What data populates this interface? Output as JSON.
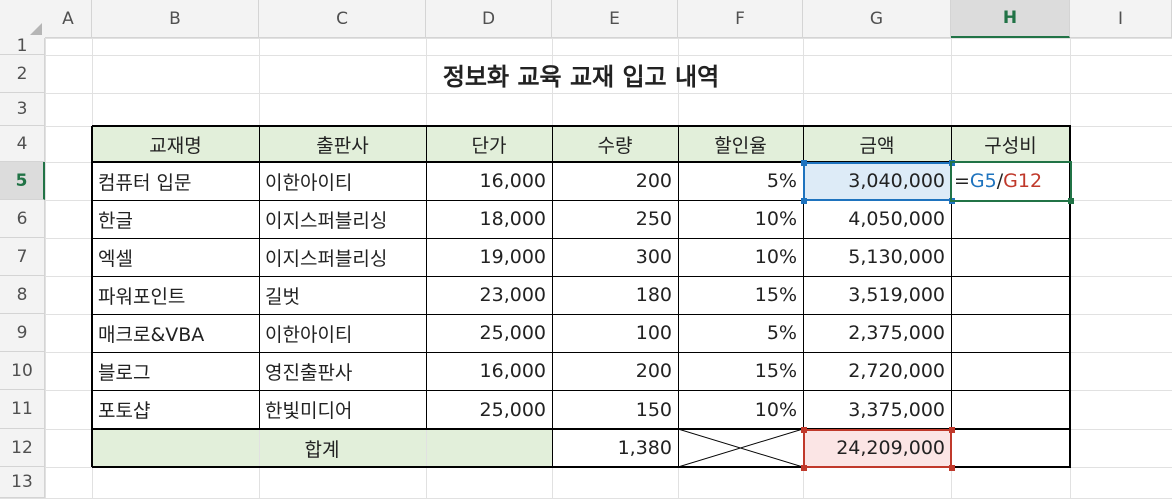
{
  "columns": [
    "A",
    "B",
    "C",
    "D",
    "E",
    "F",
    "G",
    "H",
    "I"
  ],
  "rows": [
    "1",
    "2",
    "3",
    "4",
    "5",
    "6",
    "7",
    "8",
    "9",
    "10",
    "11",
    "12",
    "13"
  ],
  "selected_column": "H",
  "selected_row": "5",
  "title": "정보화 교육 교재 입고 내역",
  "headers": [
    "교재명",
    "출판사",
    "단가",
    "수량",
    "할인율",
    "금액",
    "구성비"
  ],
  "data_rows": [
    [
      "컴퓨터 입문",
      "이한아이티",
      "16,000",
      "200",
      "5%",
      "3,040,000"
    ],
    [
      "한글",
      "이지스퍼블리싱",
      "18,000",
      "250",
      "10%",
      "4,050,000"
    ],
    [
      "엑셀",
      "이지스퍼블리싱",
      "19,000",
      "300",
      "10%",
      "5,130,000"
    ],
    [
      "파워포인트",
      "길벗",
      "23,000",
      "180",
      "15%",
      "3,519,000"
    ],
    [
      "매크로&VBA",
      "이한아이티",
      "25,000",
      "100",
      "5%",
      "2,375,000"
    ],
    [
      "블로그",
      "영진출판사",
      "16,000",
      "200",
      "15%",
      "2,720,000"
    ],
    [
      "포토샵",
      "한빛미디어",
      "25,000",
      "150",
      "10%",
      "3,375,000"
    ]
  ],
  "total": {
    "label": "합계",
    "quantity": "1,380",
    "amount": "24,209,000"
  },
  "formula": {
    "eq": "=",
    "ref1": "G5",
    "slash": "/",
    "ref2": "G12"
  },
  "colors": {
    "header_fill": "#e2efda",
    "ref1_color": "#1e73be",
    "ref2_color": "#c0392b",
    "ref1_fill": "#ddebf7",
    "ref2_fill": "#fbe5e5",
    "selection_green": "#217346"
  }
}
